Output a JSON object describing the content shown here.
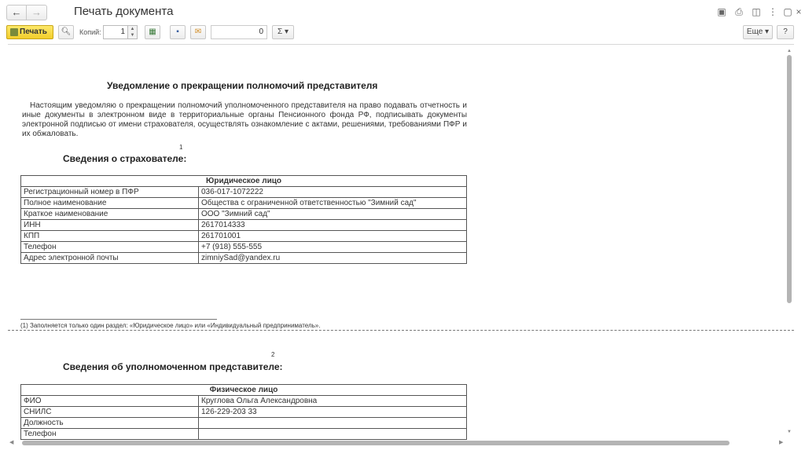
{
  "window": {
    "title": "Печать документа"
  },
  "toolbar": {
    "print_label": "Печать",
    "copies_label": "Копий:",
    "copies_value": "1",
    "sum_value": "0",
    "sigma_label": "Σ ▾",
    "more_label": "Еще ▾",
    "help_label": "?"
  },
  "document": {
    "title": "Уведомление о прекращении полномочий представителя",
    "intro": "Настоящим уведомляю о прекращении полномочий уполномоченного представителя на право подавать отчетность и иные документы в электронном виде в территориальные органы Пенсионного фонда РФ, подписывать документы электронной подписью от имени страхователя, осуществлять ознакомление с актами, решениями, требованиями ПФР и их обжаловать.",
    "section1": {
      "sup": "1",
      "heading": "Сведения о страхователе:",
      "table_header": "Юридическое лицо",
      "rows": [
        {
          "label": "Регистрационный номер в ПФР",
          "value": "036-017-1072222"
        },
        {
          "label": "Полное наименование",
          "value": "Общества с ограниченной ответственностью \"Зимний сад\""
        },
        {
          "label": "Краткое наименование",
          "value": "ООО \"Зимний сад\""
        },
        {
          "label": "ИНН",
          "value": "2617014333"
        },
        {
          "label": "КПП",
          "value": "261701001"
        },
        {
          "label": "Телефон",
          "value": "+7 (918) 555-555"
        },
        {
          "label": "Адрес электронной почты",
          "value": "zimniySad@yandex.ru"
        }
      ]
    },
    "footnote": "(1) Заполняется только один раздел: «Юридическое лицо» или «Индивидуальный предприниматель».",
    "section2": {
      "sup": "2",
      "heading": "Сведения об уполномоченном представителе:",
      "table_header": "Физическое лицо",
      "rows": [
        {
          "label": "ФИО",
          "value": "Круглова Ольга Александровна"
        },
        {
          "label": "СНИЛС",
          "value": "126-229-203 33"
        },
        {
          "label": "Должность",
          "value": ""
        },
        {
          "label": "Телефон",
          "value": ""
        }
      ]
    }
  }
}
